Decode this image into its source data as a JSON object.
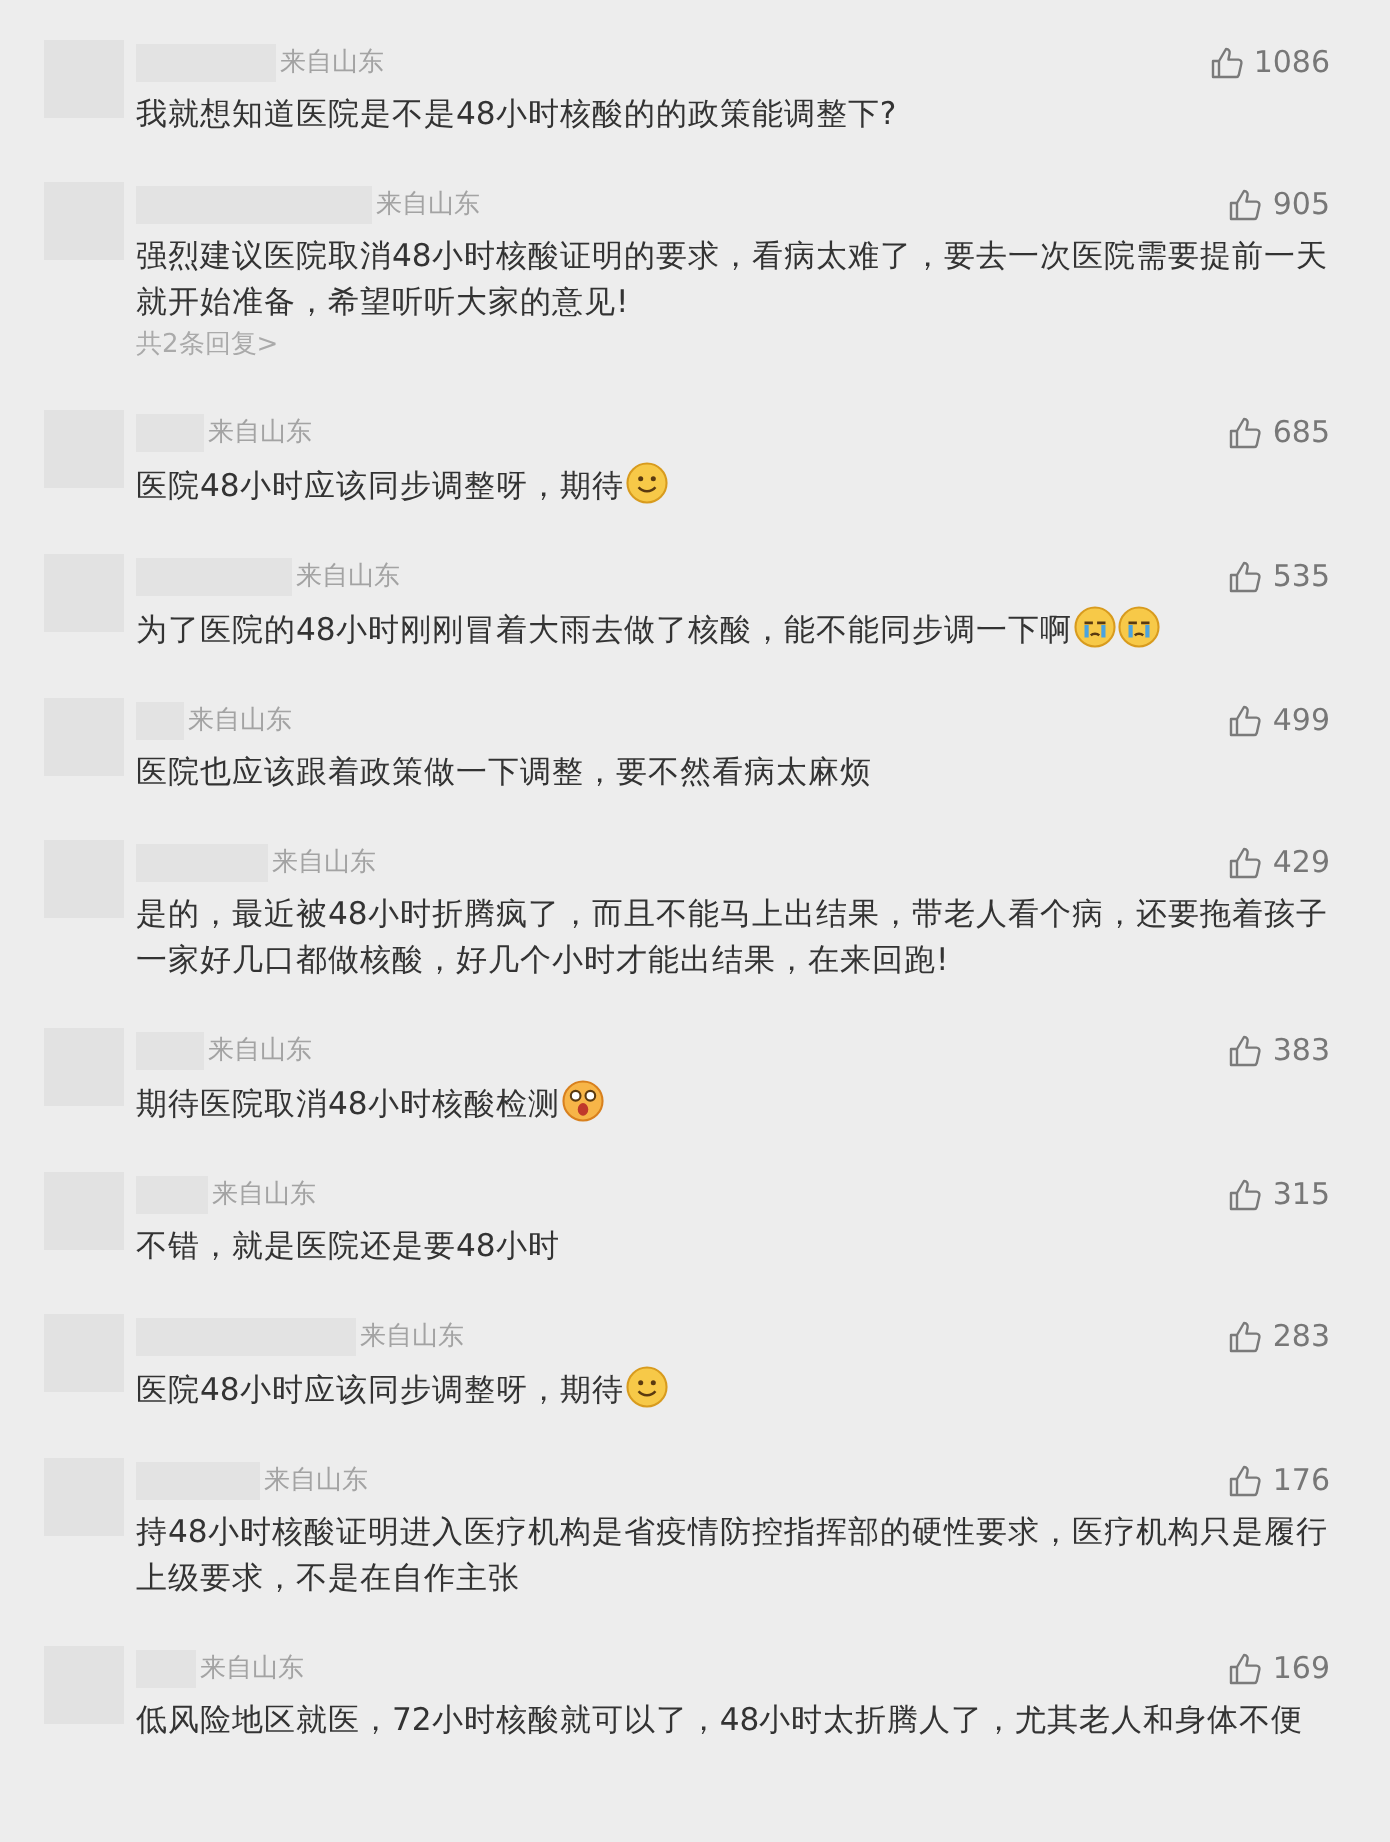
{
  "comments": [
    {
      "location": "来自山东",
      "likes": "1086",
      "text": "我就想知道医院是不是48小时核酸的的政策能调整下?"
    },
    {
      "location": "来自山东",
      "likes": "905",
      "text": "强烈建议医院取消48小时核酸证明的要求，看病太难了，要去一次医院需要提前一天就开始准备，希望听听大家的意见!",
      "replies": "共2条回复>"
    },
    {
      "location": "来自山东",
      "likes": "685",
      "text": "医院48小时应该同步调整呀，期待",
      "emojis": [
        {
          "kind": "smile"
        }
      ]
    },
    {
      "location": "来自山东",
      "likes": "535",
      "text": "为了医院的48小时刚刚冒着大雨去做了核酸，能不能同步调一下啊",
      "emojis": [
        {
          "kind": "cry"
        },
        {
          "kind": "cry"
        }
      ]
    },
    {
      "location": "来自山东",
      "likes": "499",
      "text": "医院也应该跟着政策做一下调整，要不然看病太麻烦"
    },
    {
      "location": "来自山东",
      "likes": "429",
      "text": "是的，最近被48小时折腾疯了，而且不能马上出结果，带老人看个病，还要拖着孩子一家好几口都做核酸，好几个小时才能出结果，在来回跑!"
    },
    {
      "location": "来自山东",
      "likes": "383",
      "text": "期待医院取消48小时核酸检测",
      "emojis": [
        {
          "kind": "shock"
        }
      ]
    },
    {
      "location": "来自山东",
      "likes": "315",
      "text": "不错，就是医院还是要48小时"
    },
    {
      "location": "来自山东",
      "likes": "283",
      "text": "医院48小时应该同步调整呀，期待",
      "emojis": [
        {
          "kind": "smile"
        }
      ]
    },
    {
      "location": "来自山东",
      "likes": "176",
      "text": "持48小时核酸证明进入医疗机构是省疫情防控指挥部的硬性要求，医疗机构只是履行上级要求，不是在自作主张"
    },
    {
      "location": "来自山东",
      "likes": "169",
      "text": "低风险地区就医，72小时核酸就可以了，48小时太折腾人了，尤其老人和身体不便"
    }
  ]
}
